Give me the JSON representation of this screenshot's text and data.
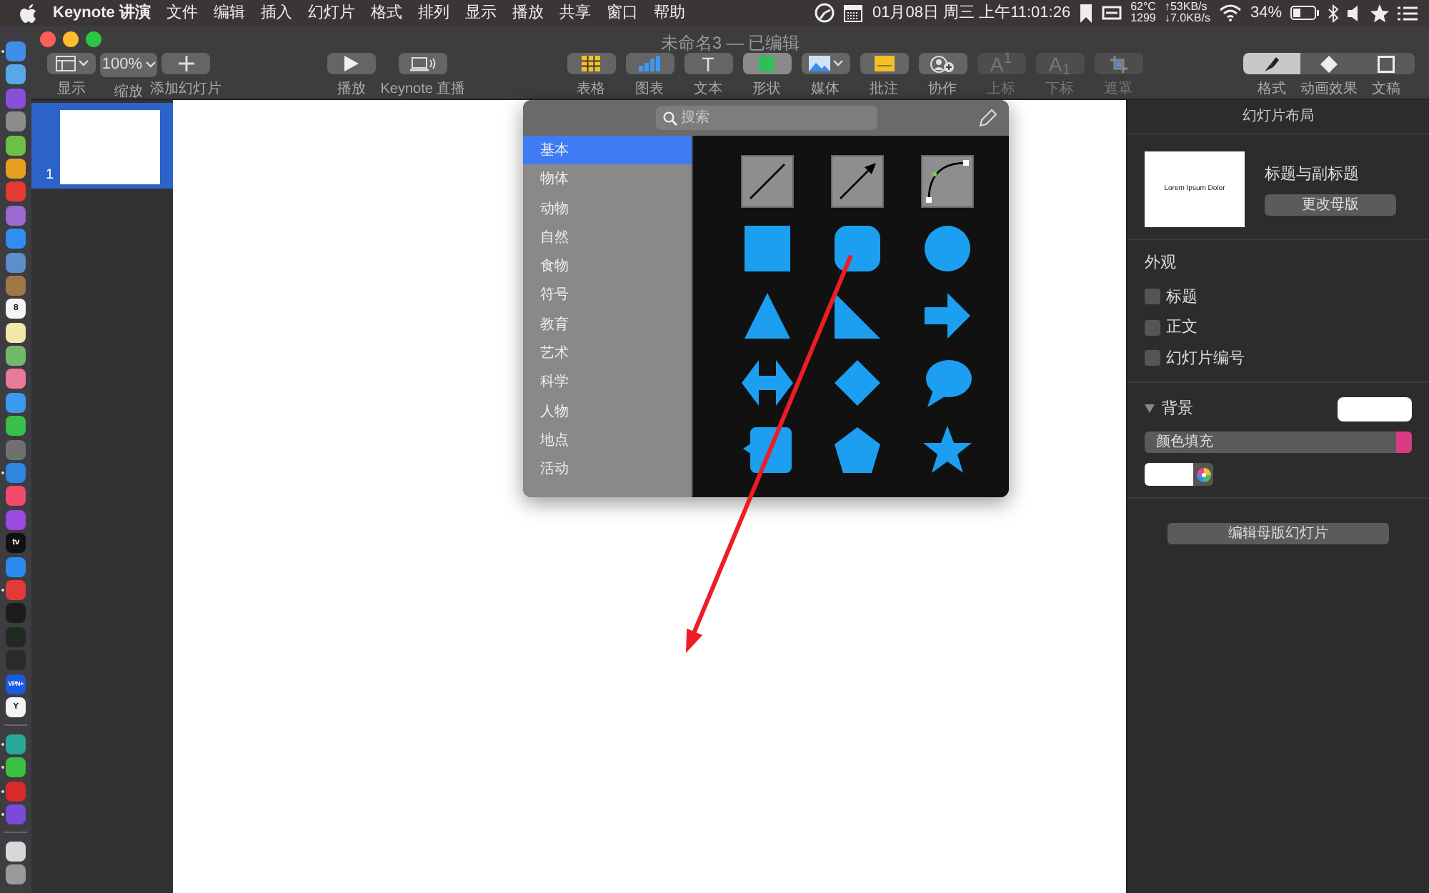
{
  "menu_bar": {
    "app_name": "Keynote 讲演",
    "menus": [
      "文件",
      "编辑",
      "插入",
      "幻灯片",
      "格式",
      "排列",
      "显示",
      "播放",
      "共享",
      "窗口",
      "帮助"
    ],
    "clock": "01月08日 周三 上午11:01:26",
    "cpu_temp": "62°C",
    "fan_speed": "1299",
    "upload": "↑53KB/s",
    "download": "↓7.0KB/s",
    "battery": "34%"
  },
  "dock": [
    {
      "kind": "app",
      "color": "#3f8ee8",
      "running": true
    },
    {
      "kind": "app",
      "color": "#58a8e8",
      "running": false
    },
    {
      "kind": "app",
      "color": "#8a4fd8",
      "running": false
    },
    {
      "kind": "app",
      "color": "#8c8c8c",
      "running": false
    },
    {
      "kind": "app",
      "color": "#6cc04a",
      "running": false
    },
    {
      "kind": "app",
      "color": "#e8a020",
      "running": false
    },
    {
      "kind": "app",
      "color": "#e43a32",
      "running": false
    },
    {
      "kind": "app",
      "color": "#9a6ad0",
      "running": false
    },
    {
      "kind": "app",
      "color": "#2f8ef0",
      "running": false
    },
    {
      "kind": "app",
      "color": "#5c8fc8",
      "running": false
    },
    {
      "kind": "app",
      "color": "#a07848",
      "running": false
    },
    {
      "kind": "app",
      "color": "#f4f4f4",
      "running": false,
      "label": "8"
    },
    {
      "kind": "app",
      "color": "#f2e9a8",
      "running": false
    },
    {
      "kind": "app",
      "color": "#74b86a",
      "running": false
    },
    {
      "kind": "app",
      "color": "#e87a9a",
      "running": false
    },
    {
      "kind": "app",
      "color": "#3a9af0",
      "running": false
    },
    {
      "kind": "app",
      "color": "#38c048",
      "running": false
    },
    {
      "kind": "app",
      "color": "#707070",
      "running": false
    },
    {
      "kind": "app",
      "color": "#2f86e0",
      "running": true
    },
    {
      "kind": "app",
      "color": "#f24a6a",
      "running": false
    },
    {
      "kind": "app",
      "color": "#9a4ae0",
      "running": false
    },
    {
      "kind": "app",
      "color": "#111111",
      "running": false,
      "label": "tv"
    },
    {
      "kind": "app",
      "color": "#2a8af0",
      "running": false
    },
    {
      "kind": "app",
      "color": "#e23a3a",
      "running": true
    },
    {
      "kind": "app",
      "color": "#1c1c1c",
      "running": false
    },
    {
      "kind": "app",
      "color": "#202a22",
      "running": false
    },
    {
      "kind": "app",
      "color": "#2a2a2a",
      "running": false
    },
    {
      "kind": "app",
      "color": "#1a5ae0",
      "running": false,
      "label": "VPN+"
    },
    {
      "kind": "app",
      "color": "#f4f4f4",
      "running": false,
      "label": "Y"
    },
    {
      "kind": "separator"
    },
    {
      "kind": "app",
      "color": "#2aa898",
      "running": true
    },
    {
      "kind": "app",
      "color": "#3ac040",
      "running": true
    },
    {
      "kind": "app",
      "color": "#d82a2a",
      "running": true
    },
    {
      "kind": "app",
      "color": "#7a4ad8",
      "running": true
    },
    {
      "kind": "separator"
    },
    {
      "kind": "app",
      "color": "#d8d8d8",
      "running": false
    },
    {
      "kind": "app",
      "color": "#9a9a9a",
      "running": false
    }
  ],
  "window": {
    "title": "未命名3 — 已编辑"
  },
  "toolbar": {
    "groups": [
      {
        "tools": [
          {
            "label": "显示",
            "kind": "view",
            "dropdown": true,
            "selected": false,
            "disabled": false
          },
          {
            "label": "缩放",
            "value": "100%",
            "dropdown": true,
            "selected": false,
            "disabled": false
          },
          {
            "label": "添加幻灯片",
            "kind": "plus",
            "dropdown": false,
            "selected": false,
            "disabled": false
          }
        ]
      },
      {
        "tools": [
          {
            "label": "播放",
            "kind": "play",
            "dropdown": false,
            "selected": false,
            "disabled": false
          },
          {
            "label": "Keynote 直播",
            "kind": "live",
            "dropdown": false,
            "selected": false,
            "disabled": false
          }
        ]
      },
      {
        "tools": [
          {
            "label": "表格",
            "kind": "table",
            "dropdown": false,
            "selected": false,
            "disabled": false
          },
          {
            "label": "图表",
            "kind": "chart",
            "dropdown": false,
            "selected": false,
            "disabled": false
          },
          {
            "label": "文本",
            "icon_text": "T",
            "dropdown": false,
            "selected": false,
            "disabled": false
          },
          {
            "label": "形状",
            "kind": "shape",
            "dropdown": false,
            "selected": true,
            "disabled": false
          },
          {
            "label": "媒体",
            "kind": "media",
            "dropdown": true,
            "selected": false,
            "disabled": false
          },
          {
            "label": "批注",
            "kind": "comment",
            "dropdown": false,
            "selected": false,
            "disabled": false
          },
          {
            "label": "协作",
            "kind": "collab",
            "dropdown": false,
            "selected": false,
            "disabled": false
          },
          {
            "label": "上标",
            "icon_text": "A$^{1}$",
            "dropdown": false,
            "selected": false,
            "disabled": true
          },
          {
            "label": "下标",
            "icon_text": "A$_{1}$",
            "dropdown": false,
            "selected": false,
            "disabled": true
          },
          {
            "label": "遮罩",
            "kind": "mask",
            "dropdown": false,
            "selected": false,
            "disabled": true
          }
        ]
      }
    ]
  },
  "inspector_tabs": [
    {
      "label": "格式",
      "kind": "brush",
      "selected": true
    },
    {
      "label": "动画效果",
      "kind": "diamond",
      "selected": false
    },
    {
      "label": "文稿",
      "kind": "document",
      "selected": false
    }
  ],
  "navigator": {
    "slides": [
      {
        "number": "1",
        "selected": true
      }
    ]
  },
  "shape_popover": {
    "search_placeholder": "搜索",
    "categories": [
      {
        "label": "基本",
        "selected": true
      },
      {
        "label": "物体",
        "selected": false
      },
      {
        "label": "动物",
        "selected": false
      },
      {
        "label": "自然",
        "selected": false
      },
      {
        "label": "食物",
        "selected": false
      },
      {
        "label": "符号",
        "selected": false
      },
      {
        "label": "教育",
        "selected": false
      },
      {
        "label": "艺术",
        "selected": false
      },
      {
        "label": "科学",
        "selected": false
      },
      {
        "label": "人物",
        "selected": false
      },
      {
        "label": "地点",
        "selected": false
      },
      {
        "label": "活动",
        "selected": false
      }
    ],
    "shapes": [
      {
        "kind": "line"
      },
      {
        "kind": "arrow-line"
      },
      {
        "kind": "curve"
      },
      {
        "kind": "square"
      },
      {
        "kind": "rounded-square"
      },
      {
        "kind": "circle"
      },
      {
        "kind": "triangle"
      },
      {
        "kind": "right-triangle"
      },
      {
        "kind": "arrow"
      },
      {
        "kind": "double-arrow"
      },
      {
        "kind": "diamond"
      },
      {
        "kind": "speech-bubble"
      },
      {
        "kind": "callout"
      },
      {
        "kind": "pentagon"
      },
      {
        "kind": "star"
      }
    ]
  },
  "inspector": {
    "heading": "幻灯片布局",
    "thumbnail_title": "Lorem Ipsum Dolor",
    "layout_name": "标题与副标题",
    "change_button": "更改母版",
    "appearance_heading": "外观",
    "options": [
      {
        "label": "标题",
        "checked": false
      },
      {
        "label": "正文",
        "checked": false
      },
      {
        "label": "幻灯片编号",
        "checked": false
      }
    ],
    "background": {
      "label": "背景",
      "expanded": true,
      "fill_type": "颜色填充"
    },
    "edit_button": "编辑母版幻灯片"
  }
}
